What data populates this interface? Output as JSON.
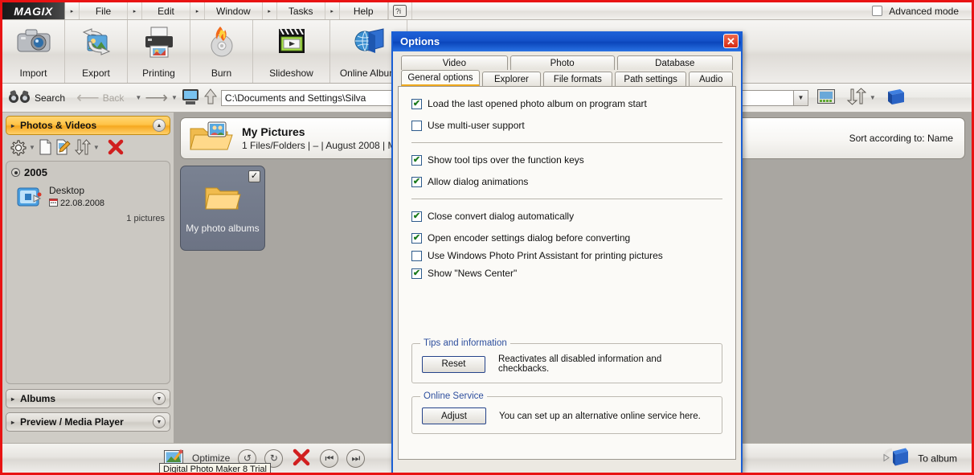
{
  "app": {
    "brand": "MAGIX",
    "advanced_mode_label": "Advanced mode"
  },
  "menubar": {
    "items": [
      {
        "label": "File",
        "accel": "F"
      },
      {
        "label": "Edit",
        "accel": "E"
      },
      {
        "label": "Window",
        "accel": "W"
      },
      {
        "label": "Tasks",
        "accel": "T"
      },
      {
        "label": "Help",
        "accel": "H"
      }
    ],
    "help_icon": "question-info-icon"
  },
  "toolbar": {
    "buttons": [
      {
        "label": "Import",
        "icon": "camera-icon"
      },
      {
        "label": "Export",
        "icon": "export-photo-icon"
      },
      {
        "label": "Printing",
        "icon": "printer-icon"
      },
      {
        "label": "Burn",
        "icon": "burn-disc-icon"
      },
      {
        "label": "Slideshow",
        "icon": "slideshow-clapper-icon"
      },
      {
        "label": "Online Album",
        "icon": "globe-book-icon"
      }
    ]
  },
  "navbar": {
    "search_label": "Search",
    "search_icon": "binoculars-icon",
    "back_label": "Back",
    "back_icon": "arrow-left-icon",
    "forward_icon": "arrow-right-icon",
    "computer_icon": "computer-icon",
    "up_icon": "arrow-up-icon",
    "path_value": "C:\\Documents and Settings\\Silva",
    "path_placeholder": "Path",
    "filter_value": "",
    "filter_placeholder": "",
    "view_icon": "view-mode-icon",
    "sort_icon": "sort-updown-icon",
    "album_icon": "blue-book-icon"
  },
  "sidebar": {
    "panels": [
      {
        "label": "Photos & Videos",
        "state": "expanded",
        "chevron": "chevron-up-icon"
      },
      {
        "label": "Albums",
        "state": "collapsed",
        "chevron": "chevron-down-icon"
      },
      {
        "label": "Preview / Media Player",
        "state": "collapsed",
        "chevron": "chevron-down-icon"
      }
    ],
    "tools": [
      {
        "icon": "gear-icon"
      },
      {
        "icon": "chevron-down-icon"
      },
      {
        "icon": "new-file-icon"
      },
      {
        "icon": "edit-file-icon"
      },
      {
        "icon": "sort-updown-icon"
      },
      {
        "icon": "chevron-down-icon"
      },
      {
        "icon": "delete-x-icon"
      }
    ],
    "tree": {
      "year": "2005",
      "entry": {
        "name": "Desktop",
        "date": "22.08.2008",
        "count": "1 pictures",
        "icon": "desktop-folder-icon",
        "date_icon": "calendar-icon"
      }
    }
  },
  "content": {
    "breadcrumb": {
      "title": "My Pictures",
      "subtitle": "1 Files/Folders | – | August 2008 | M",
      "folder_icon": "folder-people-icon"
    },
    "sort_label": "Sort according to: Name",
    "tiles": [
      {
        "label": "My photo albums",
        "icon": "folder-icon",
        "checked": true,
        "check_glyph": "✓"
      }
    ]
  },
  "bottombar": {
    "optimize_label": "Optimize",
    "optimize_icon": "optimize-wand-icon",
    "tooltip": "Digital Photo Maker 8 Trial",
    "buttons": [
      {
        "icon": "undo-icon",
        "glyph": "↺"
      },
      {
        "icon": "redo-icon",
        "glyph": "↻"
      },
      {
        "icon": "delete-x-icon",
        "glyph": "✕"
      },
      {
        "icon": "prev-icon",
        "glyph": "⏮"
      },
      {
        "icon": "next-icon",
        "glyph": "⏭"
      }
    ],
    "to_album_label": "To album",
    "to_album_icon": "to-album-book-icon"
  },
  "dialog": {
    "title": "Options",
    "close_glyph": "✕",
    "tabs_row1": [
      {
        "label": "Video",
        "active": false
      },
      {
        "label": "Photo",
        "active": false
      },
      {
        "label": "Database",
        "active": false
      }
    ],
    "tabs_row2": [
      {
        "label": "General options",
        "active": true
      },
      {
        "label": "Explorer",
        "active": false
      },
      {
        "label": "File formats",
        "active": false
      },
      {
        "label": "Path settings",
        "active": false
      },
      {
        "label": "Audio",
        "active": false
      }
    ],
    "check_glyph": "✔",
    "group_a": [
      {
        "label": "Load the last opened photo album on program start",
        "checked": true
      },
      {
        "label": "Use multi-user support",
        "checked": false
      }
    ],
    "group_b": [
      {
        "label": "Show tool tips over the function keys",
        "checked": true
      },
      {
        "label": "Allow dialog animations",
        "checked": true
      }
    ],
    "group_c": [
      {
        "label": "Close convert dialog automatically",
        "checked": true
      },
      {
        "label": "Open encoder settings dialog before converting",
        "checked": true
      },
      {
        "label": "Use Windows Photo Print Assistant for printing pictures",
        "checked": false
      },
      {
        "label": "Show \"News Center\"",
        "checked": true
      }
    ],
    "groups": [
      {
        "legend": "Tips and information",
        "button": "Reset",
        "text": "Reactivates all disabled information and checkbacks."
      },
      {
        "legend": "Online Service",
        "button": "Adjust",
        "text": "You can set up an alternative online service here."
      }
    ]
  },
  "colors": {
    "frame_red": "#e81313",
    "dialog_blue": "#1452c9",
    "panel_gold": "#f5a81f",
    "check_green": "#1b7a1b",
    "close_red": "#d62b14"
  }
}
